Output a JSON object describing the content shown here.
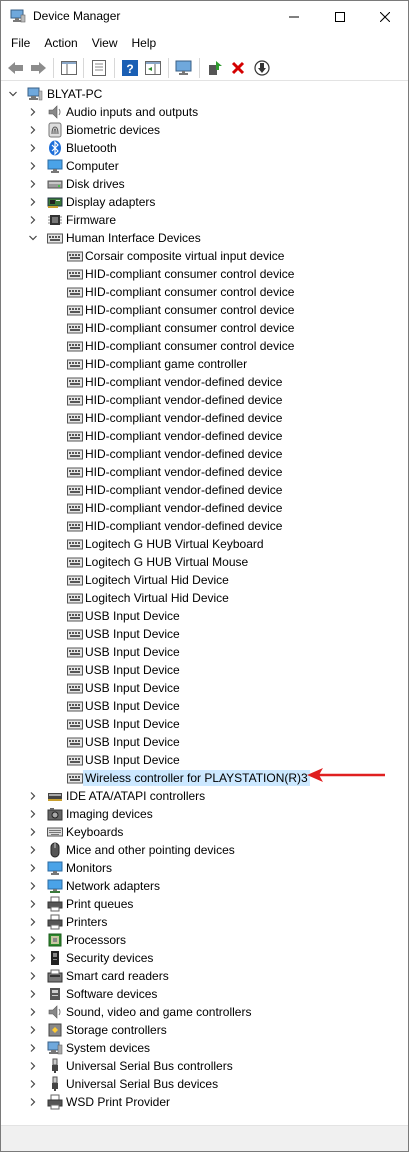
{
  "window": {
    "title": "Device Manager"
  },
  "menu": [
    "File",
    "Action",
    "View",
    "Help"
  ],
  "toolbar": [
    {
      "icon": "back-arrow-icon"
    },
    {
      "icon": "forward-arrow-icon"
    },
    {
      "icon": "show-hide-console-tree-icon"
    },
    {
      "icon": "properties-icon"
    },
    {
      "icon": "help-icon"
    },
    {
      "icon": "action-pane-icon"
    },
    {
      "icon": "scan-hardware-changes-icon"
    },
    {
      "icon": "update-driver-icon"
    },
    {
      "icon": "uninstall-device-icon"
    },
    {
      "icon": "disable-device-icon"
    }
  ],
  "tree": [
    {
      "label": "BLYAT-PC",
      "level": 0,
      "state": "expanded",
      "icon": "computer"
    },
    {
      "label": "Audio inputs and outputs",
      "level": 1,
      "state": "collapsed",
      "icon": "speaker"
    },
    {
      "label": "Biometric devices",
      "level": 1,
      "state": "collapsed",
      "icon": "fingerprint"
    },
    {
      "label": "Bluetooth",
      "level": 1,
      "state": "collapsed",
      "icon": "bluetooth"
    },
    {
      "label": "Computer",
      "level": 1,
      "state": "collapsed",
      "icon": "monitor"
    },
    {
      "label": "Disk drives",
      "level": 1,
      "state": "collapsed",
      "icon": "disk"
    },
    {
      "label": "Display adapters",
      "level": 1,
      "state": "collapsed",
      "icon": "display-adapter"
    },
    {
      "label": "Firmware",
      "level": 1,
      "state": "collapsed",
      "icon": "chip"
    },
    {
      "label": "Human Interface Devices",
      "level": 1,
      "state": "expanded",
      "icon": "hid"
    },
    {
      "label": "Corsair composite virtual input device",
      "level": 2,
      "state": "leaf",
      "icon": "hid"
    },
    {
      "label": "HID-compliant consumer control device",
      "level": 2,
      "state": "leaf",
      "icon": "hid"
    },
    {
      "label": "HID-compliant consumer control device",
      "level": 2,
      "state": "leaf",
      "icon": "hid"
    },
    {
      "label": "HID-compliant consumer control device",
      "level": 2,
      "state": "leaf",
      "icon": "hid"
    },
    {
      "label": "HID-compliant consumer control device",
      "level": 2,
      "state": "leaf",
      "icon": "hid"
    },
    {
      "label": "HID-compliant consumer control device",
      "level": 2,
      "state": "leaf",
      "icon": "hid"
    },
    {
      "label": "HID-compliant game controller",
      "level": 2,
      "state": "leaf",
      "icon": "hid"
    },
    {
      "label": "HID-compliant vendor-defined device",
      "level": 2,
      "state": "leaf",
      "icon": "hid"
    },
    {
      "label": "HID-compliant vendor-defined device",
      "level": 2,
      "state": "leaf",
      "icon": "hid"
    },
    {
      "label": "HID-compliant vendor-defined device",
      "level": 2,
      "state": "leaf",
      "icon": "hid"
    },
    {
      "label": "HID-compliant vendor-defined device",
      "level": 2,
      "state": "leaf",
      "icon": "hid"
    },
    {
      "label": "HID-compliant vendor-defined device",
      "level": 2,
      "state": "leaf",
      "icon": "hid"
    },
    {
      "label": "HID-compliant vendor-defined device",
      "level": 2,
      "state": "leaf",
      "icon": "hid"
    },
    {
      "label": "HID-compliant vendor-defined device",
      "level": 2,
      "state": "leaf",
      "icon": "hid"
    },
    {
      "label": "HID-compliant vendor-defined device",
      "level": 2,
      "state": "leaf",
      "icon": "hid"
    },
    {
      "label": "HID-compliant vendor-defined device",
      "level": 2,
      "state": "leaf",
      "icon": "hid"
    },
    {
      "label": "Logitech G HUB Virtual Keyboard",
      "level": 2,
      "state": "leaf",
      "icon": "hid"
    },
    {
      "label": "Logitech G HUB Virtual Mouse",
      "level": 2,
      "state": "leaf",
      "icon": "hid"
    },
    {
      "label": "Logitech Virtual Hid Device",
      "level": 2,
      "state": "leaf",
      "icon": "hid"
    },
    {
      "label": "Logitech Virtual Hid Device",
      "level": 2,
      "state": "leaf",
      "icon": "hid"
    },
    {
      "label": "USB Input Device",
      "level": 2,
      "state": "leaf",
      "icon": "hid"
    },
    {
      "label": "USB Input Device",
      "level": 2,
      "state": "leaf",
      "icon": "hid"
    },
    {
      "label": "USB Input Device",
      "level": 2,
      "state": "leaf",
      "icon": "hid"
    },
    {
      "label": "USB Input Device",
      "level": 2,
      "state": "leaf",
      "icon": "hid"
    },
    {
      "label": "USB Input Device",
      "level": 2,
      "state": "leaf",
      "icon": "hid"
    },
    {
      "label": "USB Input Device",
      "level": 2,
      "state": "leaf",
      "icon": "hid"
    },
    {
      "label": "USB Input Device",
      "level": 2,
      "state": "leaf",
      "icon": "hid"
    },
    {
      "label": "USB Input Device",
      "level": 2,
      "state": "leaf",
      "icon": "hid"
    },
    {
      "label": "USB Input Device",
      "level": 2,
      "state": "leaf",
      "icon": "hid"
    },
    {
      "label": "Wireless controller for PLAYSTATION(R)3",
      "level": 2,
      "state": "leaf",
      "icon": "hid",
      "selected": true
    },
    {
      "label": "IDE ATA/ATAPI controllers",
      "level": 1,
      "state": "collapsed",
      "icon": "ide"
    },
    {
      "label": "Imaging devices",
      "level": 1,
      "state": "collapsed",
      "icon": "camera"
    },
    {
      "label": "Keyboards",
      "level": 1,
      "state": "collapsed",
      "icon": "keyboard"
    },
    {
      "label": "Mice and other pointing devices",
      "level": 1,
      "state": "collapsed",
      "icon": "mouse"
    },
    {
      "label": "Monitors",
      "level": 1,
      "state": "collapsed",
      "icon": "monitor"
    },
    {
      "label": "Network adapters",
      "level": 1,
      "state": "collapsed",
      "icon": "network"
    },
    {
      "label": "Print queues",
      "level": 1,
      "state": "collapsed",
      "icon": "printer"
    },
    {
      "label": "Printers",
      "level": 1,
      "state": "collapsed",
      "icon": "printer"
    },
    {
      "label": "Processors",
      "level": 1,
      "state": "collapsed",
      "icon": "processor"
    },
    {
      "label": "Security devices",
      "level": 1,
      "state": "collapsed",
      "icon": "security"
    },
    {
      "label": "Smart card readers",
      "level": 1,
      "state": "collapsed",
      "icon": "smartcard"
    },
    {
      "label": "Software devices",
      "level": 1,
      "state": "collapsed",
      "icon": "software"
    },
    {
      "label": "Sound, video and game controllers",
      "level": 1,
      "state": "collapsed",
      "icon": "speaker"
    },
    {
      "label": "Storage controllers",
      "level": 1,
      "state": "collapsed",
      "icon": "storage"
    },
    {
      "label": "System devices",
      "level": 1,
      "state": "collapsed",
      "icon": "system"
    },
    {
      "label": "Universal Serial Bus controllers",
      "level": 1,
      "state": "collapsed",
      "icon": "usb"
    },
    {
      "label": "Universal Serial Bus devices",
      "level": 1,
      "state": "collapsed",
      "icon": "usb"
    },
    {
      "label": "WSD Print Provider",
      "level": 1,
      "state": "collapsed",
      "icon": "printer"
    }
  ],
  "colors": {
    "selection": "#cce8ff",
    "annotation_arrow": "#e02020",
    "uninstall_red": "#d40000",
    "help_blue": "#1a5fb4"
  }
}
